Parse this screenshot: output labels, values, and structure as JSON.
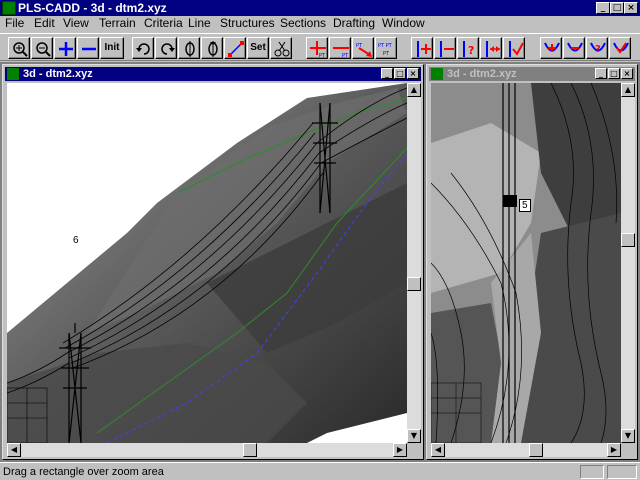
{
  "window": {
    "title": "PLS-CADD - 3d - dtm2.xyz",
    "minimize": "_",
    "maximize": "□",
    "close": "×"
  },
  "menu": {
    "items": [
      "File",
      "Edit",
      "View",
      "Terrain",
      "Criteria",
      "Line",
      "Structures",
      "Sections",
      "Drafting",
      "Window"
    ]
  },
  "toolbar": {
    "init_label": "Init",
    "set_label": "Set"
  },
  "left_view": {
    "title": "3d - dtm2.xyz",
    "label": "6"
  },
  "right_view": {
    "title": "3d - dtm2.xyz",
    "label": "5"
  },
  "status": {
    "message": "Drag a rectangle over zoom area"
  },
  "colors": {
    "title_active": "#000080",
    "title_inactive": "#808080",
    "tool_red": "#ff0000",
    "tool_blue": "#0000ff"
  }
}
